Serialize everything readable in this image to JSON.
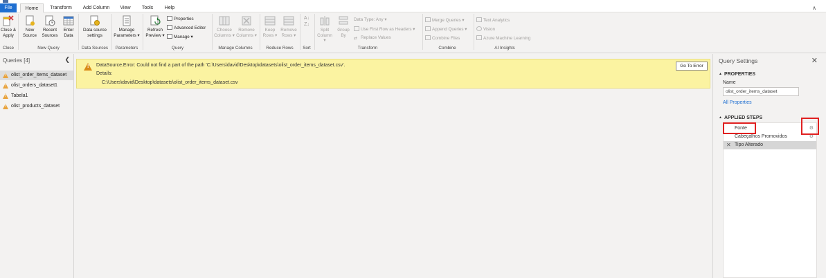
{
  "tabs": [
    "File",
    "Home",
    "Transform",
    "Add Column",
    "View",
    "Tools",
    "Help"
  ],
  "ribbon": {
    "close": {
      "btn1": "Close &",
      "btn1b": "Apply",
      "label": "Close"
    },
    "new_query": {
      "new": "New",
      "new_b": "Source",
      "recent": "Recent",
      "recent_b": "Sources",
      "enter": "Enter",
      "enter_b": "Data",
      "label": "New Query"
    },
    "data_sources": {
      "btn": "Data source",
      "btn_b": "settings",
      "label": "Data Sources"
    },
    "parameters": {
      "btn": "Manage",
      "btn_b": "Parameters",
      "label": "Parameters"
    },
    "query": {
      "refresh": "Refresh",
      "refresh_b": "Preview",
      "properties": "Properties",
      "advanced": "Advanced Editor",
      "manage": "Manage",
      "label": "Query"
    },
    "manage_columns": {
      "choose": "Choose",
      "choose_b": "Columns",
      "remove": "Remove",
      "remove_b": "Columns",
      "label": "Manage Columns"
    },
    "reduce_rows": {
      "keep": "Keep",
      "keep_b": "Rows",
      "remove": "Remove",
      "remove_b": "Rows",
      "label": "Reduce Rows"
    },
    "sort": {
      "label": "Sort"
    },
    "transform": {
      "split": "Split",
      "split_b": "Column",
      "group": "Group",
      "group_b": "By",
      "datatype": "Data Type: Any",
      "first_row": "Use First Row as Headers",
      "replace": "Replace Values",
      "label": "Transform"
    },
    "combine": {
      "merge": "Merge Queries",
      "append": "Append Queries",
      "combine_files": "Combine Files",
      "label": "Combine"
    },
    "ai": {
      "text": "Text Analytics",
      "vision": "Vision",
      "azure": "Azure Machine Learning",
      "label": "AI Insights"
    }
  },
  "queries_pane": {
    "header": "Queries [4]",
    "items": [
      "olist_order_items_dataset",
      "olist_orders_dataset1",
      "Tabela1",
      "olist_products_dataset"
    ]
  },
  "error": {
    "message": "DataSource.Error: Could not find a part of the path 'C:\\Users\\david\\Desktop\\datasets\\olist_order_items_dataset.csv'.",
    "details_label": "Details:",
    "path": "C:\\Users\\david\\Desktop\\datasets\\olist_order_items_dataset.csv",
    "button": "Go To Error"
  },
  "settings": {
    "title": "Query Settings",
    "properties_head": "PROPERTIES",
    "name_label": "Name",
    "name_value": "olist_order_items_dataset",
    "all_properties": "All Properties",
    "steps_head": "APPLIED STEPS",
    "steps": [
      "Fonte",
      "Cabeçalhos Promovidos",
      "Tipo Alterado"
    ]
  },
  "colors": {
    "file_tab": "#1f6fd1",
    "error_bg": "#fbf3a1",
    "warning": "#e8a33d",
    "highlight_box": "#e02020"
  }
}
